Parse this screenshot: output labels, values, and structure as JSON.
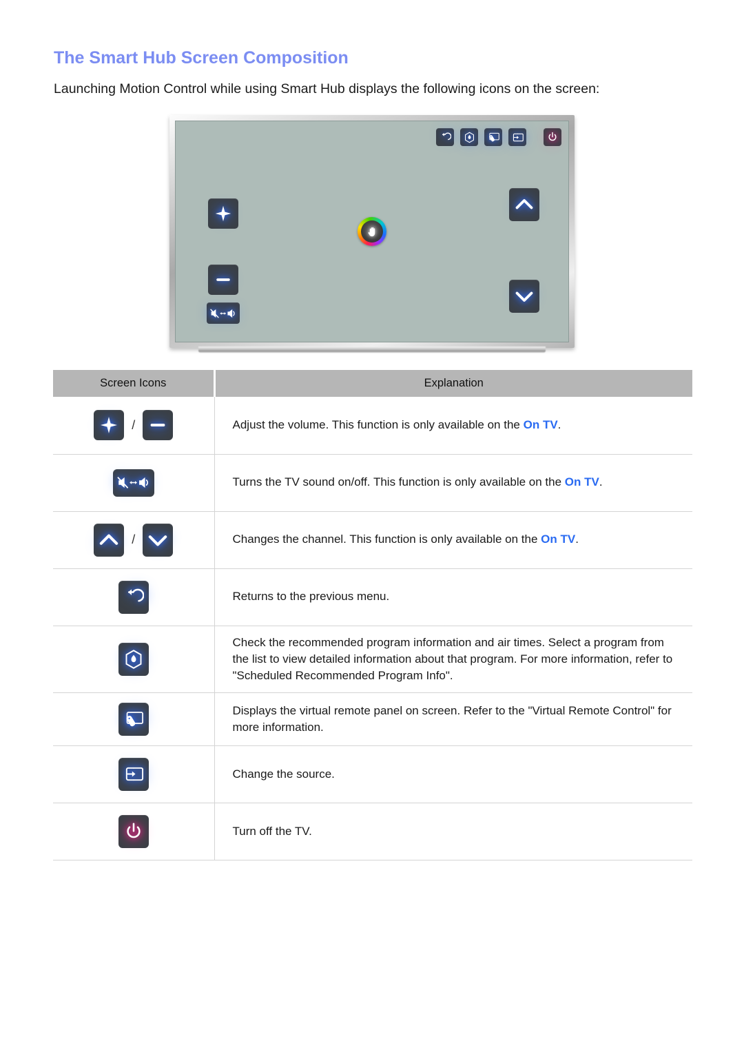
{
  "page": {
    "title": "The Smart Hub Screen Composition",
    "intro": "Launching Motion Control while using Smart Hub displays the following icons on the screen:",
    "title_color": "#7b8df2",
    "link_color": "#2a6bf2"
  },
  "tv_illustration": {
    "screen_color": "#aebcb8",
    "bezel_color": "#c6c6c6",
    "cursor": {
      "icon": "hand-cursor-icon",
      "ring": "rainbow"
    },
    "top_icons": [
      {
        "icon": "return-icon",
        "name": "return"
      },
      {
        "icon": "recommended-program-icon",
        "name": "recommended"
      },
      {
        "icon": "virtual-remote-icon",
        "name": "virtual-remote"
      },
      {
        "icon": "source-icon",
        "name": "source"
      },
      {
        "icon": "power-icon",
        "name": "power"
      }
    ],
    "side_icons": [
      {
        "icon": "volume-up-icon",
        "name": "volume-up"
      },
      {
        "icon": "volume-down-icon",
        "name": "volume-down"
      },
      {
        "icon": "mute-toggle-icon",
        "name": "mute"
      },
      {
        "icon": "channel-up-icon",
        "name": "channel-up"
      },
      {
        "icon": "channel-down-icon",
        "name": "channel-down"
      }
    ]
  },
  "table": {
    "headers": {
      "icons": "Screen Icons",
      "explanation": "Explanation"
    },
    "rows": [
      {
        "icons": [
          "volume-up-icon",
          "volume-down-icon"
        ],
        "separator": "/",
        "text_before": "Adjust the volume. This function is only available on the ",
        "link": "On TV",
        "text_after": "."
      },
      {
        "icons": [
          "mute-toggle-icon"
        ],
        "separator": "",
        "text_before": "Turns the TV sound on/off. This function is only available on the ",
        "link": "On TV",
        "text_after": "."
      },
      {
        "icons": [
          "channel-up-icon",
          "channel-down-icon"
        ],
        "separator": "/",
        "text_before": "Changes the channel. This function is only available on the ",
        "link": "On TV",
        "text_after": "."
      },
      {
        "icons": [
          "return-icon"
        ],
        "separator": "",
        "text_before": "Returns to the previous menu.",
        "link": "",
        "text_after": ""
      },
      {
        "icons": [
          "recommended-program-icon"
        ],
        "separator": "",
        "text_before": "Check the recommended program information and air times. Select a program from the list to view detailed information about that program. For more information, refer to \"Scheduled Recommended Program Info\".",
        "link": "",
        "text_after": ""
      },
      {
        "icons": [
          "virtual-remote-icon"
        ],
        "separator": "",
        "text_before": "Displays the virtual remote panel on screen. Refer to the \"Virtual Remote Control\" for more information.",
        "link": "",
        "text_after": ""
      },
      {
        "icons": [
          "source-icon"
        ],
        "separator": "",
        "text_before": "Change the source.",
        "link": "",
        "text_after": ""
      },
      {
        "icons": [
          "power-icon"
        ],
        "separator": "",
        "text_before": "Turn off the TV.",
        "link": "",
        "text_after": ""
      }
    ]
  }
}
